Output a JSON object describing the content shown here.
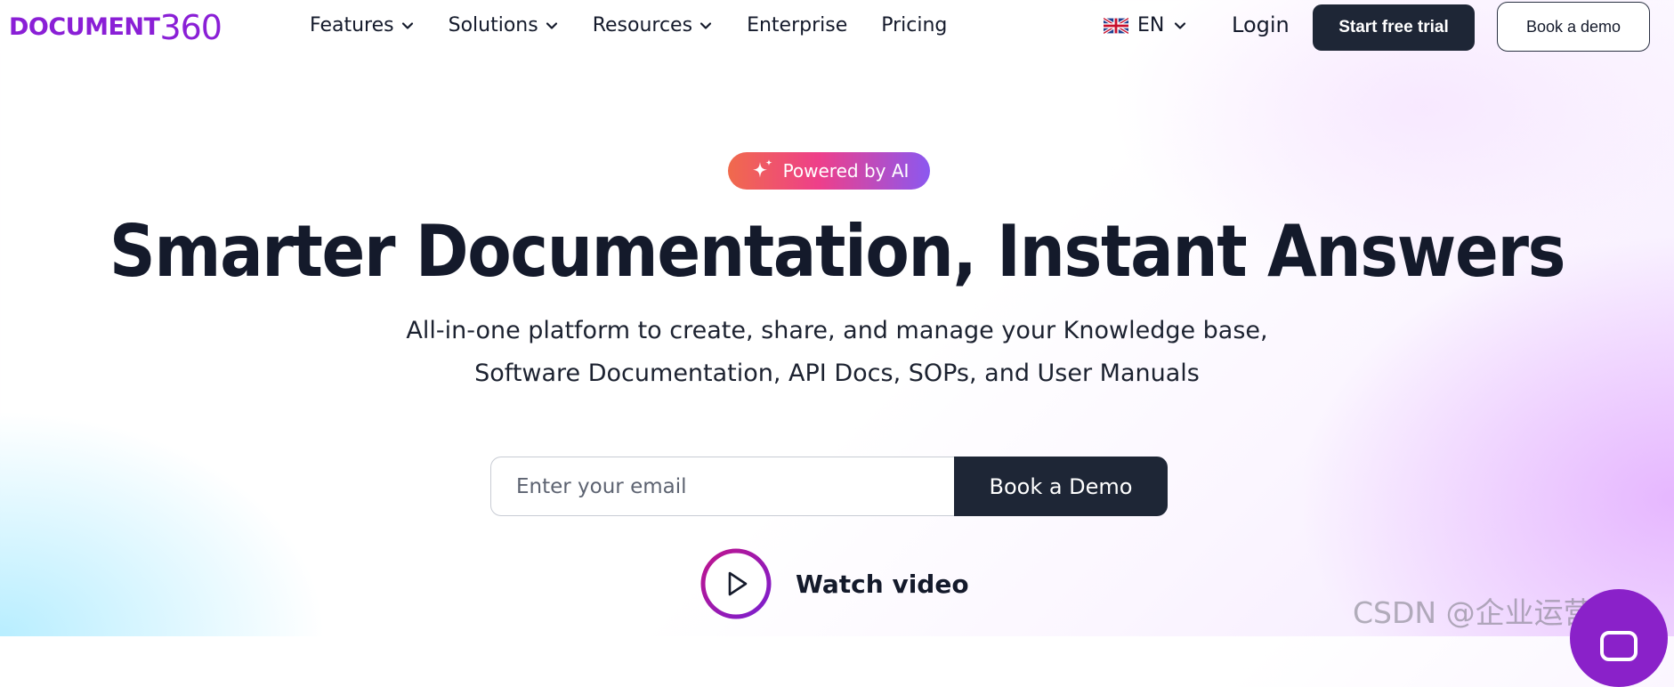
{
  "brand": {
    "logo_word": "DOCUMENT",
    "logo_num": "360",
    "color": "#8a1fd6"
  },
  "nav": {
    "items": [
      {
        "label": "Features",
        "has_dropdown": true
      },
      {
        "label": "Solutions",
        "has_dropdown": true
      },
      {
        "label": "Resources",
        "has_dropdown": true
      },
      {
        "label": "Enterprise",
        "has_dropdown": false
      },
      {
        "label": "Pricing",
        "has_dropdown": false
      }
    ],
    "language": "EN",
    "language_flag": "uk-flag-icon",
    "login_label": "Login",
    "trial_label": "Start free trial",
    "demo_label": "Book a demo"
  },
  "hero": {
    "badge": "Powered by AI",
    "title": "Smarter Documentation, Instant Answers",
    "subtitle_line1": "All-in-one platform to create, share, and manage your Knowledge base,",
    "subtitle_line2": "Software Documentation, API Docs, SOPs, and User Manuals",
    "email_placeholder": "Enter your email",
    "book_demo_label": "Book a Demo",
    "watch_label": "Watch video"
  },
  "watermark": {
    "text": "CSDN @企业运营学堂"
  },
  "colors": {
    "dark": "#1e2636",
    "text": "#141a2b",
    "badge_start": "#f06a4c",
    "badge_mid": "#ee3f8a",
    "badge_end": "#8b58f0",
    "chat": "#8a21c9"
  }
}
